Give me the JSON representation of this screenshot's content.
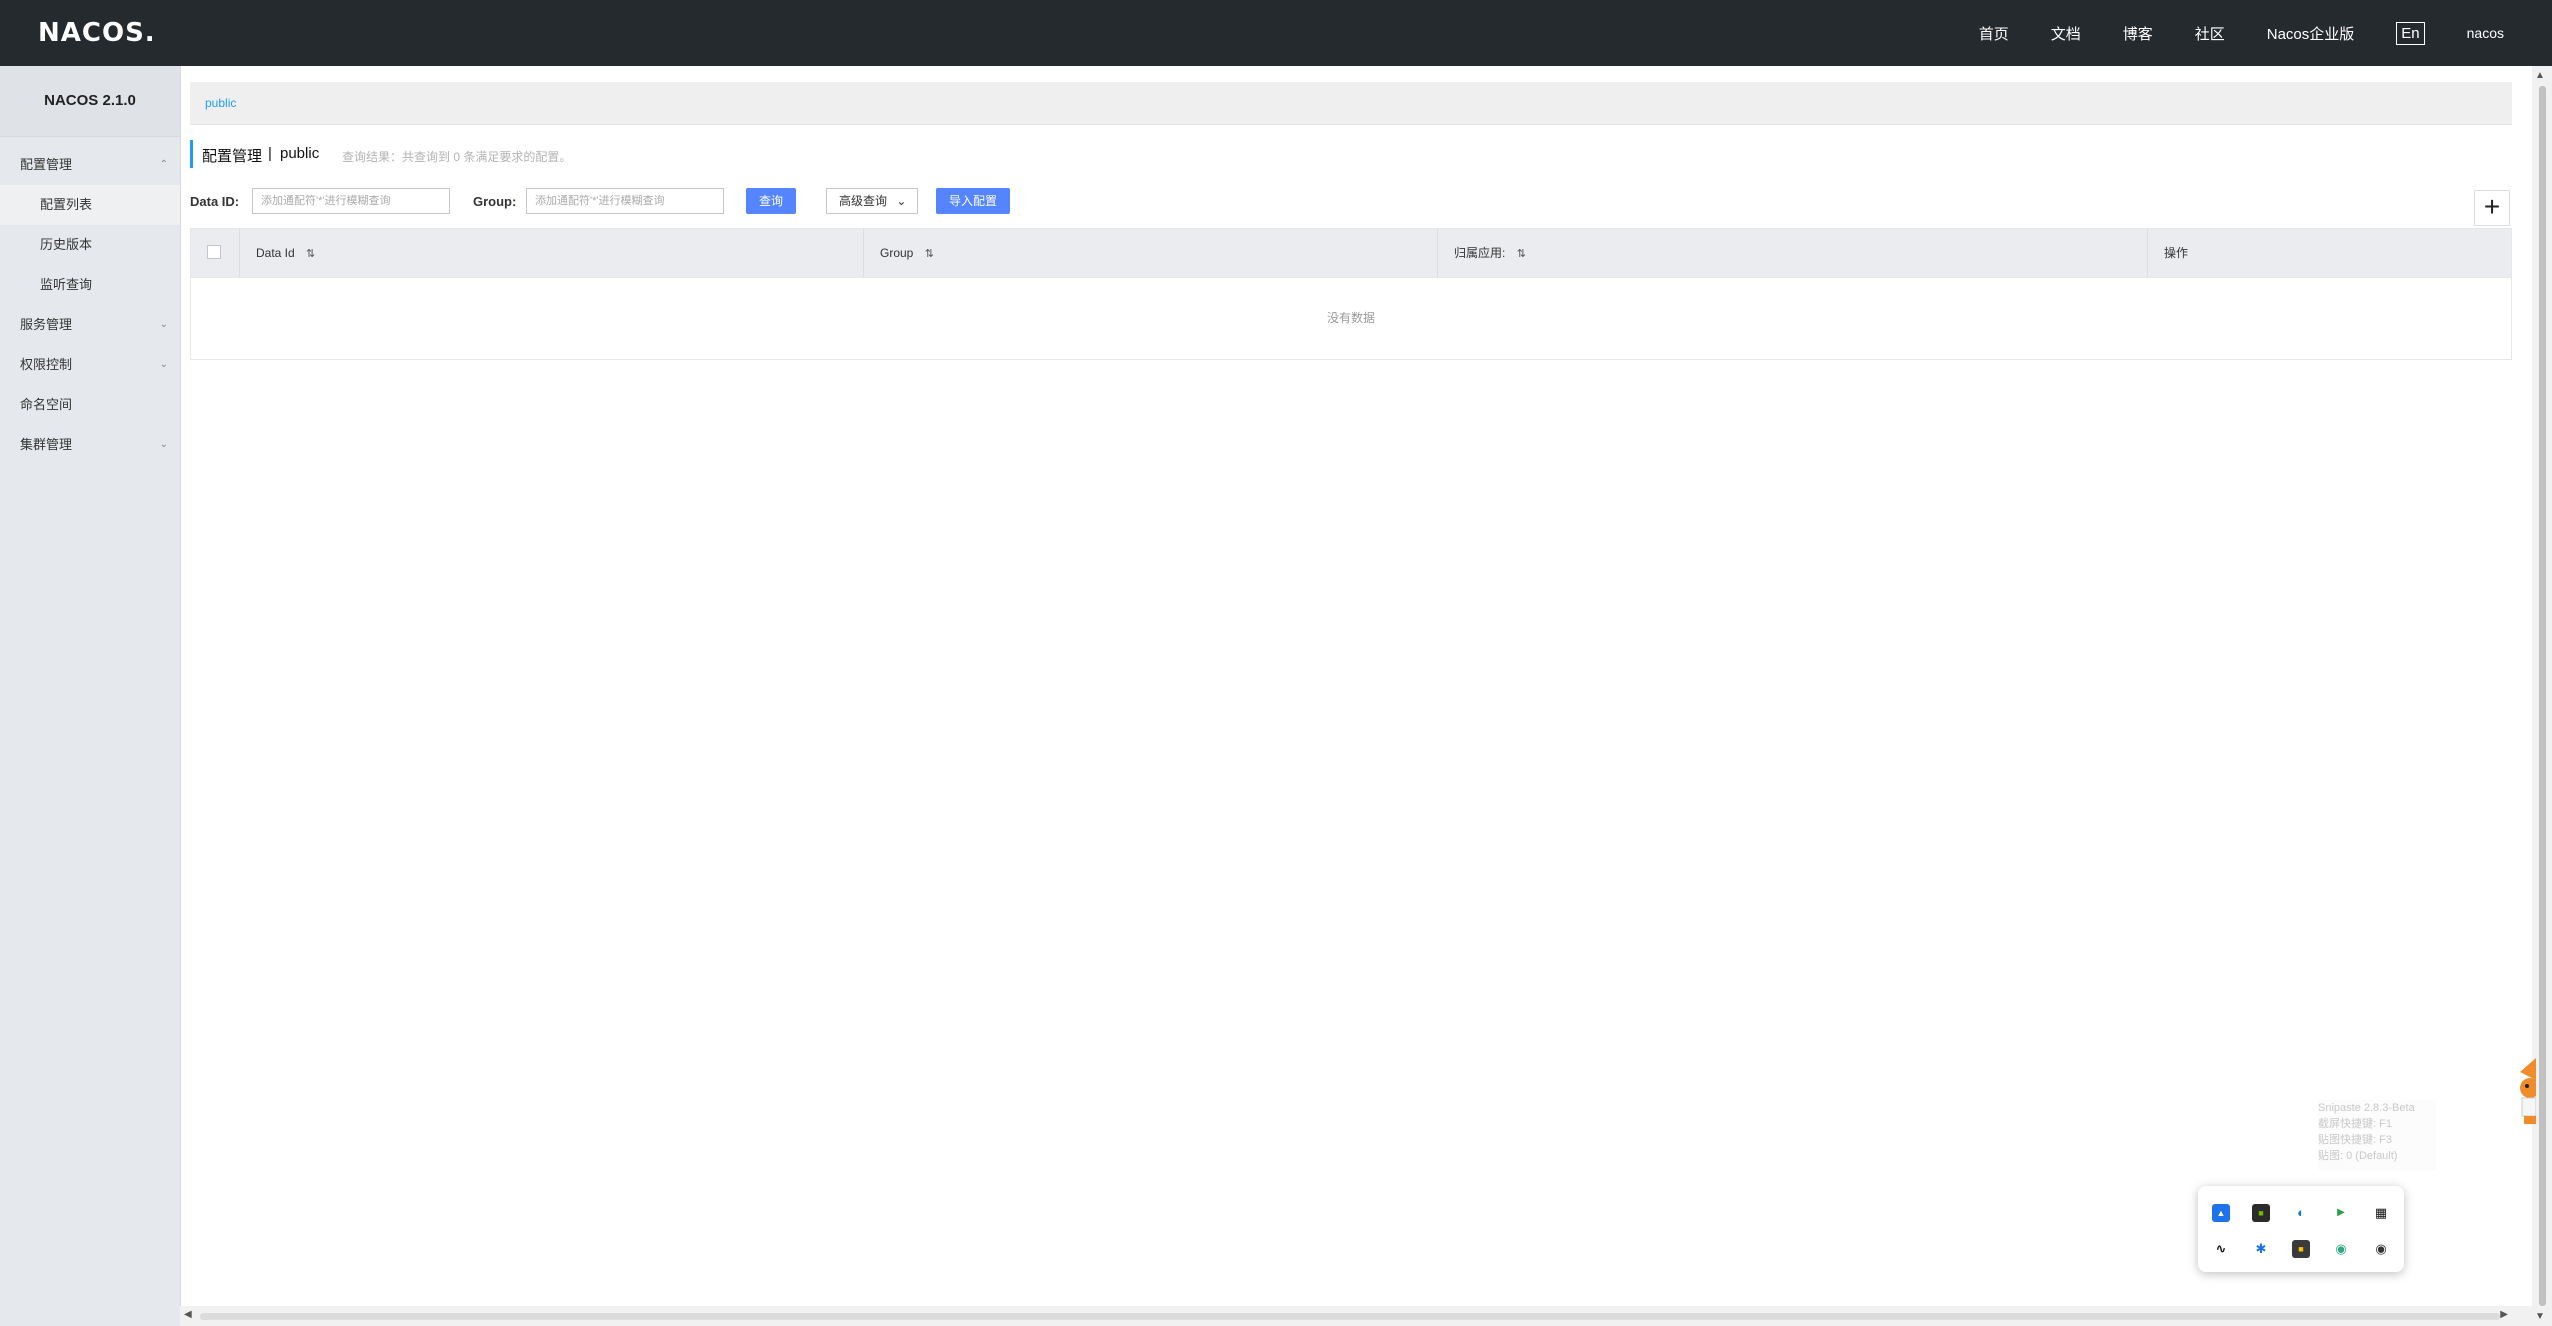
{
  "header": {
    "logo": "NACOS.",
    "nav": [
      "首页",
      "文档",
      "博客",
      "社区",
      "Nacos企业版"
    ],
    "language": "En",
    "user": "nacos"
  },
  "sidebar": {
    "version": "NACOS 2.1.0",
    "items": [
      {
        "label": "配置管理",
        "expanded": true
      },
      {
        "label": "配置列表",
        "sub": true,
        "active": true
      },
      {
        "label": "历史版本",
        "sub": true
      },
      {
        "label": "监听查询",
        "sub": true
      },
      {
        "label": "服务管理",
        "expanded": false
      },
      {
        "label": "权限控制",
        "expanded": false
      },
      {
        "label": "命名空间"
      },
      {
        "label": "集群管理",
        "expanded": false
      }
    ]
  },
  "namespace": {
    "current": "public"
  },
  "title": {
    "section": "配置管理",
    "separator": "|",
    "namespace": "public",
    "result_hint": "查询结果：共查询到 0 条满足要求的配置。"
  },
  "filter": {
    "data_id_label": "Data ID:",
    "data_id_placeholder": "添加通配符'*'进行模糊查询",
    "group_label": "Group:",
    "group_placeholder": "添加通配符'*'进行模糊查询",
    "query_button": "查询",
    "advanced_query": "高级查询",
    "import_button": "导入配置"
  },
  "table": {
    "columns": [
      "Data Id",
      "Group",
      "归属应用:",
      "操作"
    ],
    "empty_text": "没有数据"
  },
  "snipaste": {
    "lines": [
      "Snipaste 2.8.3-Beta",
      "截屏快捷键: F1",
      "贴图快捷键: F3",
      "贴图: 0 (Default)"
    ]
  },
  "colors": {
    "topbar": "#252a2f",
    "sidebar": "#e5e8ec",
    "primary": "#5584ff",
    "link": "#209bfa"
  }
}
